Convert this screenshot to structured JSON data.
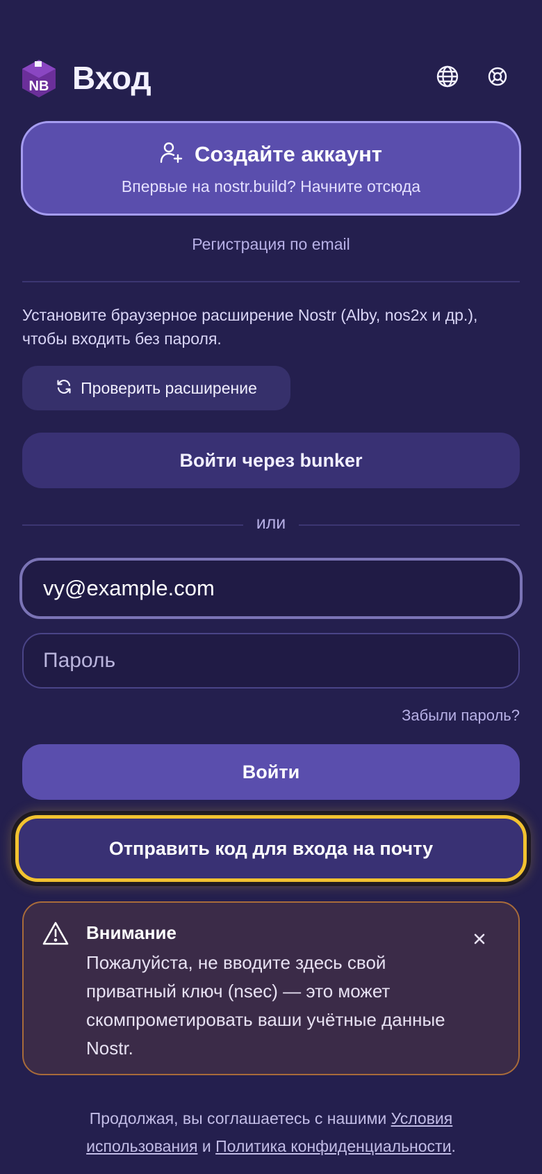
{
  "header": {
    "title": "Вход",
    "logo_text": "NB",
    "language_icon": "globe-icon",
    "help_icon": "lifebuoy-icon"
  },
  "create_account": {
    "title": "Создайте аккаунт",
    "subtitle": "Впервые на nostr.build? Начните отсюда",
    "icon": "user-plus-icon"
  },
  "email_registration_link": "Регистрация по email",
  "extension": {
    "text": "Установите браузерное расширение Nostr (Alby, nos2x и др.), чтобы входить без пароля.",
    "check_button": "Проверить расширение",
    "check_icon": "refresh-icon"
  },
  "bunker_button": "Войти через bunker",
  "or_separator": "или",
  "form": {
    "email_value": "vy@example.com",
    "password_placeholder": "Пароль",
    "forgot_link": "Забыли пароль?",
    "login_button": "Войти",
    "email_code_button": "Отправить код для входа на почту"
  },
  "warning": {
    "title": "Внимание",
    "text": "Пожалуйста, не вводите здесь свой приватный ключ (nsec) — это может скомпрометировать ваши учётные данные Nostr.",
    "close": "×",
    "icon": "warning-triangle-icon"
  },
  "terms": {
    "prefix": "Продолжая, вы соглашаетесь с нашими",
    "terms_link": "Условия использования",
    "and": "и",
    "privacy_link": "Политика конфиденциальности",
    "suffix": "."
  },
  "colors": {
    "background": "#241f4e",
    "primary": "#5a4ead",
    "secondary": "#393174",
    "focus_ring": "#f2c230",
    "warning_border": "#a86b3a"
  }
}
